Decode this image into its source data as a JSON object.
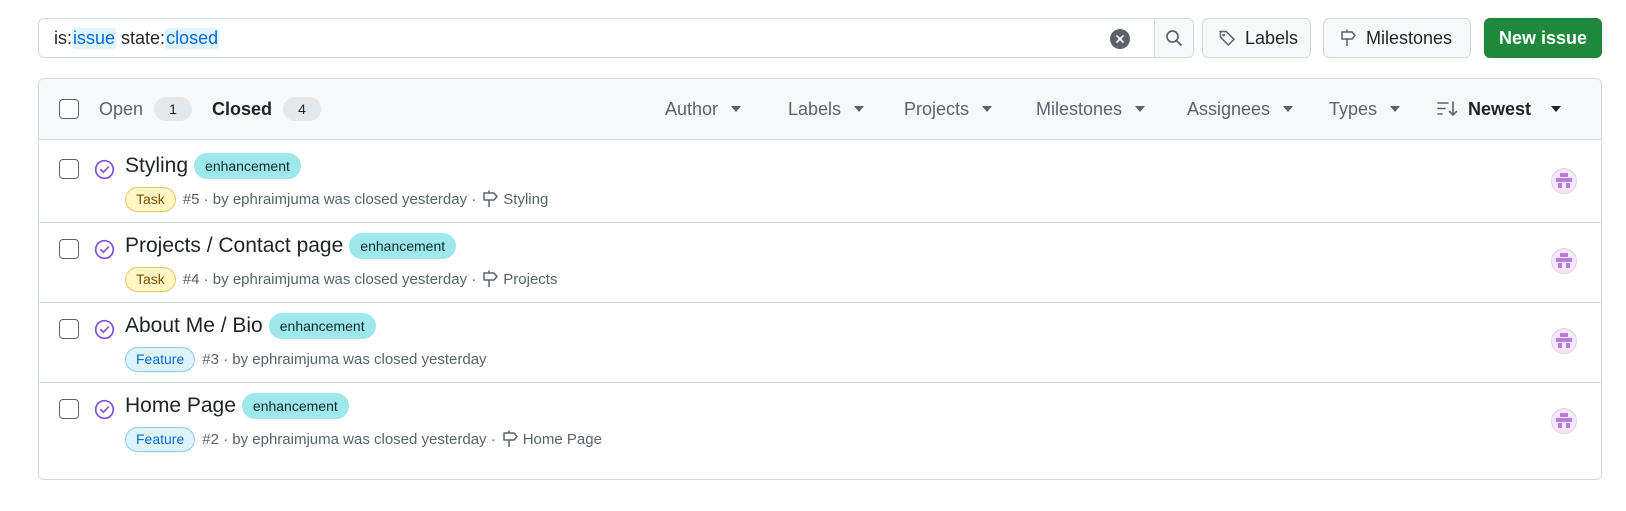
{
  "search": {
    "tokens": [
      {
        "key": "is:",
        "value": "issue"
      },
      {
        "key": " state:",
        "value": "closed"
      }
    ],
    "clear_icon": "x-circle-fill-icon",
    "search_icon": "search-icon"
  },
  "toolbar": {
    "labels_label": "Labels",
    "milestones_label": "Milestones",
    "new_issue_label": "New issue",
    "labels_icon": "tag-icon",
    "milestones_icon": "milestone-icon"
  },
  "header": {
    "open_label": "Open",
    "open_count": "1",
    "closed_label": "Closed",
    "closed_count": "4",
    "filters": [
      "Author",
      "Labels",
      "Projects",
      "Milestones",
      "Assignees",
      "Types"
    ],
    "sort_label": "Newest",
    "sort_icon": "sort-desc-icon"
  },
  "issues": [
    {
      "title": "Styling",
      "label": "enhancement",
      "type": "Task",
      "meta": "#5 · by ephraimjuma was closed yesterday ·",
      "milestone": "Styling"
    },
    {
      "title": "Projects / Contact page",
      "label": "enhancement",
      "type": "Task",
      "meta": "#4 · by ephraimjuma was closed yesterday ·",
      "milestone": "Projects"
    },
    {
      "title": "About Me / Bio",
      "label": "enhancement",
      "type": "Feature",
      "meta": "#3 · by ephraimjuma was closed yesterday",
      "milestone": ""
    },
    {
      "title": "Home Page",
      "label": "enhancement",
      "type": "Feature",
      "meta": "#2 · by ephraimjuma was closed yesterday ·",
      "milestone": "Home Page"
    }
  ],
  "colors": {
    "accent_green": "#1f883d",
    "closed_purple": "#8250df",
    "label_enhancement": "#9ee7ea",
    "task_badge": "#fff8c5",
    "feature_badge": "#ddf4ff"
  }
}
